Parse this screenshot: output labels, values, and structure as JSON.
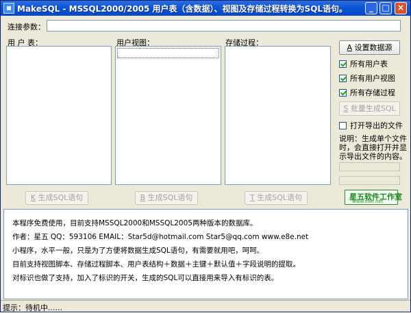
{
  "window": {
    "title": "MakeSQL - MSSQL2000/2005 用户表（含数据）、视图及存储过程转换为SQL语句。"
  },
  "connection": {
    "label": "连接参数：",
    "value": ""
  },
  "lists": {
    "tables": {
      "label": "用 户 表："
    },
    "views": {
      "label": "用户视图："
    },
    "procs": {
      "label": "存储过程："
    }
  },
  "buttons": {
    "gen_tables": {
      "key": "K",
      "text": " 生成SQL语句"
    },
    "gen_views": {
      "key": "B",
      "text": " 生成SQL语句"
    },
    "gen_procs": {
      "key": "T",
      "text": " 生成SQL语句"
    },
    "set_source": {
      "key": "A",
      "text": " 设置数据源"
    },
    "batch_gen": {
      "key": "S",
      "text": " 批量生成SQL"
    }
  },
  "checkboxes": {
    "all_tables": {
      "label": "所有用户表",
      "checked": true
    },
    "all_views": {
      "label": "所有用户视图",
      "checked": true
    },
    "all_procs": {
      "label": "所有存储过程",
      "checked": true
    },
    "open_file": {
      "label": "打开导出的文件",
      "checked": false
    }
  },
  "note": {
    "lines": [
      "说明：生成单个文件",
      "时，会直接打开并显",
      "示导出文件的内容。"
    ]
  },
  "logo": {
    "main": "星五软件工作室",
    "sub": "www.e8e.net"
  },
  "info": {
    "lines": [
      "本程序免费使用，目前支持MSSQL2000和MSSQL2005两种版本的数据库。",
      "作者：星五 QQ：593106 EMAIL：Star5d@hotmail.com Star5@qq.com www.e8e.net",
      "小程序，水平一般，只是为了方便将数据生成SQL语句，有需要就用吧，呵呵。",
      "目前支持视图脚本、存储过程脚本、用户表结构＋数据＋主键＋默认值＋字段说明的提取。",
      "对标识也做了支持，加入了标识的开关，生成的SQL可以直接用来导入有标识的表。"
    ]
  },
  "status": {
    "text": "提示：待机中......"
  },
  "colors": {
    "titlebar": "#0a56d8",
    "window_bg": "#ece9d8",
    "logo_green": "#1a8a1a",
    "close_button": "#d8532c"
  }
}
